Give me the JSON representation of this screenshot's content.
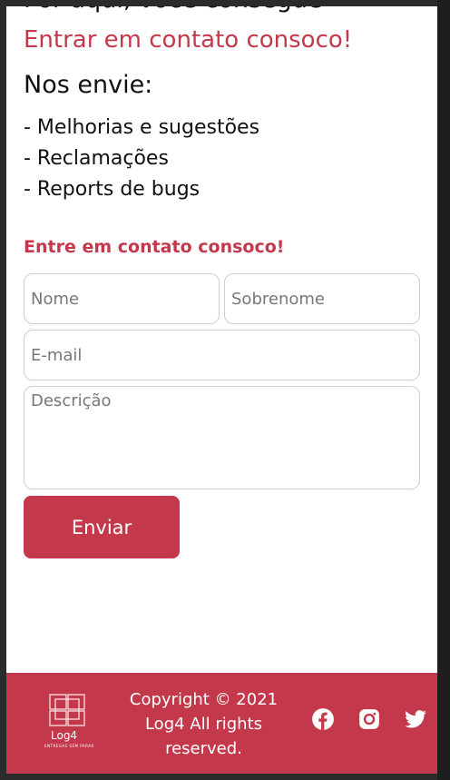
{
  "intro": {
    "cut_line": "Por aqui, você consegue",
    "red_line": "Entrar em contato consoco!",
    "nos_envie": "Nos envie:",
    "bullets": [
      "- Melhorias e sugestões",
      "- Reclamações",
      "- Reports de bugs"
    ]
  },
  "form": {
    "title": "Entre em contato consoco!",
    "nome_placeholder": "Nome",
    "sobrenome_placeholder": "Sobrenome",
    "email_placeholder": "E-mail",
    "descricao_placeholder": "Descrição",
    "submit_label": "Enviar"
  },
  "footer": {
    "logo_name": "Log4",
    "logo_tagline": "ENTREGAS SEM PARAR",
    "copyright": "Copyright © 2021 Log4 All rights reserved.",
    "social_icons": [
      "facebook-icon",
      "instagram-icon",
      "twitter-icon"
    ]
  },
  "colors": {
    "accent": "#c4384c",
    "background": "#ffffff",
    "frame": "#2b2b2b"
  }
}
